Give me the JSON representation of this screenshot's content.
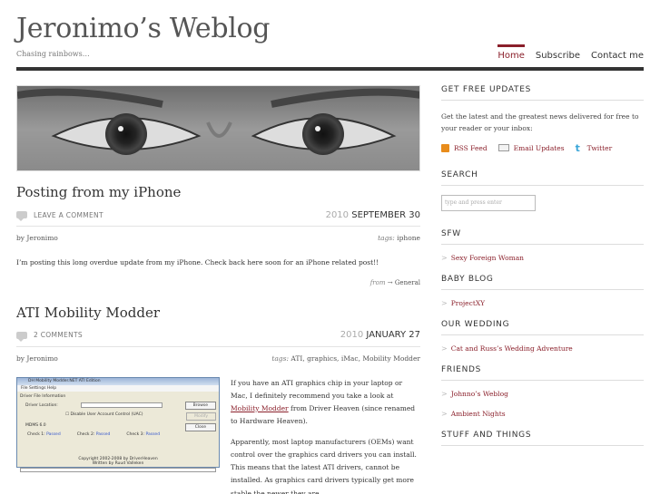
{
  "header": {
    "title": "Jeronimo’s Weblog",
    "tagline": "Chasing rainbows…",
    "nav": [
      "Home",
      "Subscribe",
      "Contact me"
    ]
  },
  "posts": [
    {
      "title": "Posting from my iPhone",
      "comments": "LEAVE A COMMENT",
      "date_year": "2010",
      "date_day": "SEPTEMBER 30",
      "author": "by Jeronimo",
      "tags_label": "tags:",
      "tags": "iphone",
      "body": "I’m posting this long overdue update from my iPhone. Check back here soon for an iPhone related post!!",
      "from_label": "from",
      "from_arrow": "→",
      "category": "General"
    },
    {
      "title": "ATI Mobility Modder",
      "comments": "2 COMMENTS",
      "date_year": "2010",
      "date_day": "JANUARY 27",
      "author": "by Jeronimo",
      "tags_label": "tags:",
      "tags": "ATI, graphics, iMac, Mobility Modder",
      "para1_a": "If you have an ATI graphics chip in your laptop or Mac, I definitely recommend you take a look at",
      "para1_link": "Mobility Modder",
      "para1_b": "from Driver Heaven (since renamed to Hardware Heaven).",
      "para2": "Apparently, most laptop manufacturers (OEMs) want control over the graphics card drivers you can install. This means that the latest ATI drivers, cannot be installed. As graphics card drivers typically get more stable the newer they are,"
    }
  ],
  "dialog": {
    "title": "DH Mobility Modder.NET ATI Edition",
    "menu": "File   Settings   Help",
    "field_group": "Driver File Information",
    "driver_location": "Driver Location:",
    "browse": "Browse",
    "checkbox": "Disable User Account Control (UAC)",
    "modify": "Modify",
    "close": "Close",
    "version": "MDMS 6.0",
    "check1": "Check 1:",
    "check2": "Check 2:",
    "check3": "Check 3:",
    "passed": "Passed",
    "copyright": "Copyright 2002-2008 by DriverHeaven",
    "written": "Written by Ruud Valleken"
  },
  "sidebar": {
    "free_updates_title": "GET FREE UPDATES",
    "free_updates_text": "Get the latest and the greatest news delivered for free to your reader or your inbox:",
    "rss": "RSS Feed",
    "email": "Email Updates",
    "twitter": "Twitter",
    "search_title": "SEARCH",
    "search_placeholder": "type and press enter",
    "sfw_title": "SFW",
    "sfw_items": [
      "Sexy Foreign Woman"
    ],
    "baby_title": "BABY BLOG",
    "baby_items": [
      "ProjectXY"
    ],
    "wedding_title": "OUR WEDDING",
    "wedding_items": [
      "Cat and Russ’s Wedding Adventure"
    ],
    "friends_title": "FRIENDS",
    "friends_items": [
      "Johnno’s Weblog",
      "Ambient Nights"
    ],
    "stuff_title": "STUFF AND THINGS"
  },
  "colors": {
    "accent": "#8a1f2a",
    "bar": "#333333"
  },
  "icons": [
    "comment-bubble-icon",
    "rss-icon",
    "email-icon",
    "twitter-icon",
    "arrow-bullet-icon"
  ]
}
